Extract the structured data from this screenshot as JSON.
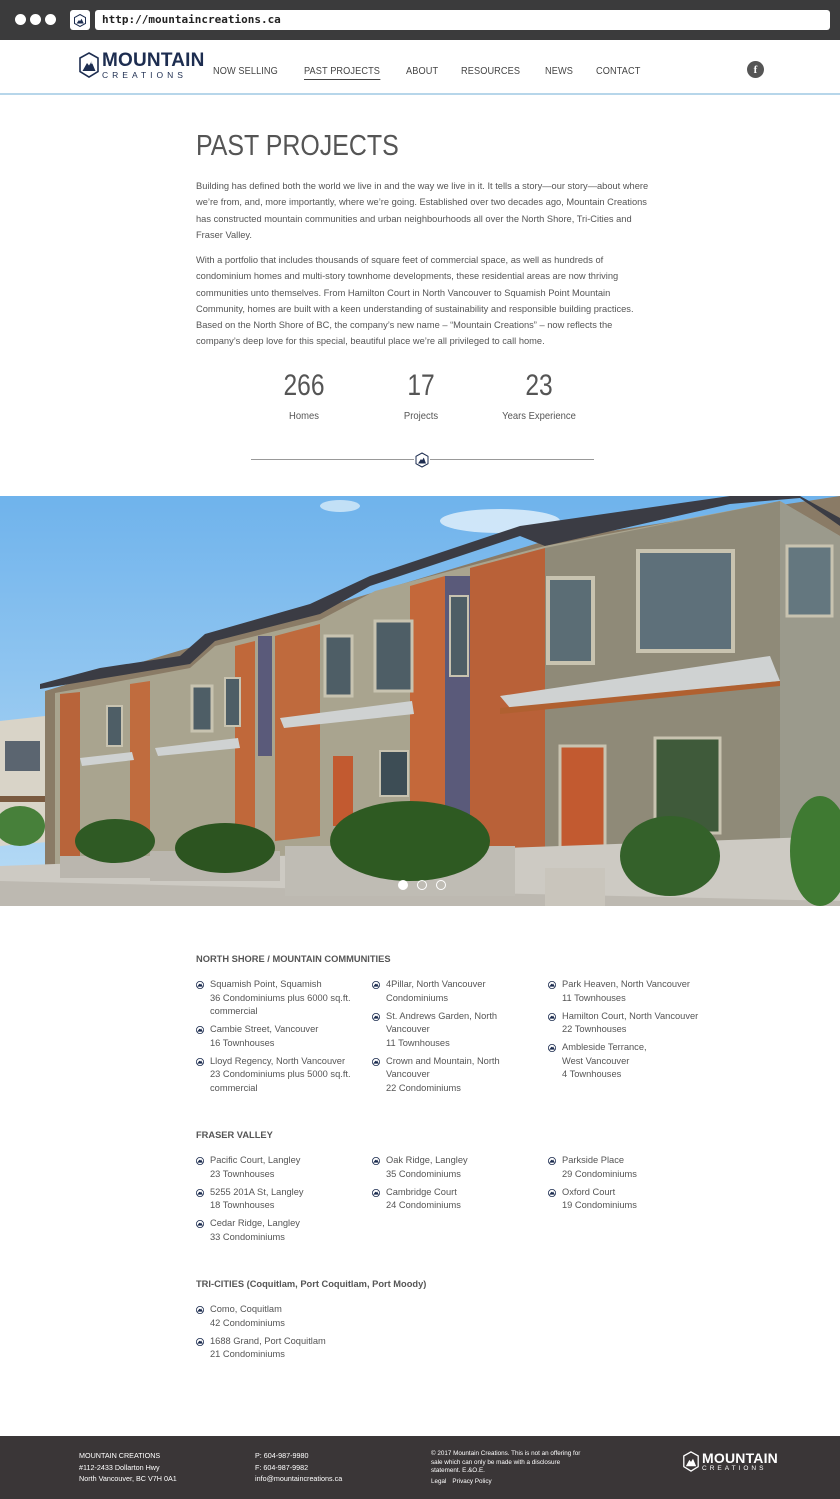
{
  "browser": {
    "url": "http://mountaincreations.ca"
  },
  "brand": {
    "name": "MOUNTAIN",
    "sub": "CREATIONS",
    "navy": "#1d2d50"
  },
  "nav": {
    "items": [
      {
        "label": "NOW SELLING",
        "active": false
      },
      {
        "label": "PAST PROJECTS",
        "active": true
      },
      {
        "label": "ABOUT",
        "active": false
      },
      {
        "label": "RESOURCES",
        "active": false
      },
      {
        "label": "NEWS",
        "active": false
      },
      {
        "label": "CONTACT",
        "active": false
      }
    ],
    "social_icon": "facebook-icon",
    "social_label": "f"
  },
  "intro": {
    "title": "PAST PROJECTS",
    "p1": "Building has defined both the world we live in and the way we live in it. It tells a story—our story—about where we’re from, and, more importantly, where we’re going. Established over two decades ago, Mountain Creations has constructed mountain communities and urban neighbourhoods all over the North Shore, Tri-Cities and Fraser Valley.",
    "p2": "With a portfolio that includes thousands of square feet of commercial space, as well as hundreds of condominium homes and multi-story townhome developments, these residential areas are now thriving communities unto themselves. From Hamilton Court in North Vancouver to Squamish Point Mountain Community, homes are built with a keen understanding of sustainability and responsible building practices. Based on the North Shore of BC, the company’s new name – “Mountain Creations” – now reflects the company’s deep love for this special, beautiful place we’re all privileged to call home."
  },
  "stats": [
    {
      "value": "266",
      "label": "Homes"
    },
    {
      "value": "17",
      "label": "Projects"
    },
    {
      "value": "23",
      "label": "Years Experience"
    }
  ],
  "carousel": {
    "slides": 3,
    "active": 0
  },
  "sections": {
    "north_shore": {
      "title": "NORTH SHORE / MOUNTAIN COMMUNITIES",
      "columns": [
        [
          {
            "name": "Squamish Point, Squamish",
            "detail": "36 Condominiums plus 6000 sq.ft. commercial"
          },
          {
            "name": "Cambie Street, Vancouver",
            "detail": "16 Townhouses"
          },
          {
            "name": "Lloyd Regency, North Vancouver",
            "detail": "23 Condominiums plus 5000 sq.ft. commercial"
          }
        ],
        [
          {
            "name": "4Pillar, North Vancouver",
            "detail": "Condominiums"
          },
          {
            "name": "St. Andrews Garden, North Vancouver",
            "detail": "11 Townhouses"
          },
          {
            "name": "Crown and Mountain, North Vancouver",
            "detail": "22 Condominiums"
          }
        ],
        [
          {
            "name": "Park Heaven, North Vancouver",
            "detail": "11 Townhouses"
          },
          {
            "name": "Hamilton Court, North Vancouver",
            "detail": "22 Townhouses"
          },
          {
            "name": "Ambleside Terrance, West Vancouver",
            "detail": "4 Townhouses"
          }
        ]
      ]
    },
    "fraser_valley": {
      "title": "FRASER VALLEY",
      "columns": [
        [
          {
            "name": "Pacific Court, Langley",
            "detail": "23 Townhouses"
          },
          {
            "name": "5255 201A St, Langley",
            "detail": "18 Townhouses"
          },
          {
            "name": "Cedar Ridge, Langley",
            "detail": "33 Condominiums"
          }
        ],
        [
          {
            "name": "Oak Ridge, Langley",
            "detail": "35 Condominiums"
          },
          {
            "name": "Cambridge Court",
            "detail": "24 Condominiums"
          }
        ],
        [
          {
            "name": "Parkside Place",
            "detail": "29 Condominiums"
          },
          {
            "name": "Oxford Court",
            "detail": "19 Condominiums"
          }
        ]
      ]
    },
    "tri_cities": {
      "title": "TRI-CITIES (Coquitlam, Port Coquitlam, Port Moody)",
      "columns": [
        [
          {
            "name": "Como, Coquitlam",
            "detail": "42 Condominiums"
          },
          {
            "name": "1688 Grand, Port Coquitlam",
            "detail": "21 Condominiums"
          }
        ]
      ]
    }
  },
  "footer": {
    "company": "MOUNTAIN CREATIONS",
    "address1": "#112-2433 Dollarton Hwy",
    "address2": "North Vancouver, BC V7H 0A1",
    "phone": "P: 604-987-9980",
    "fax": "F: 604-987-9982",
    "email": "info@mountaincreations.ca",
    "copyright": "© 2017 Mountain Creations. This is not an offering for sale which can only be made with a disclosure statement. E.&O.E.",
    "legal": "Legal",
    "privacy": "Privacy Policy"
  }
}
